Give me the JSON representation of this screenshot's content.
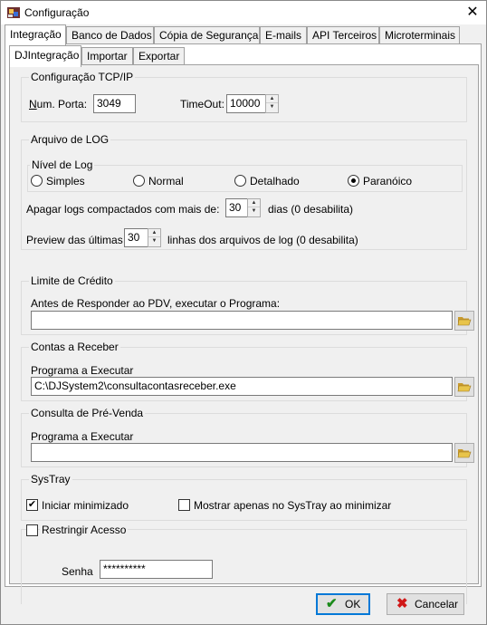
{
  "window": {
    "title": "Configuração",
    "close_glyph": "✕"
  },
  "main_tabs": [
    {
      "label": "Integração",
      "active": true
    },
    {
      "label": "Banco de Dados"
    },
    {
      "label": "Cópia de Segurança"
    },
    {
      "label": "E-mails"
    },
    {
      "label": "API Terceiros"
    },
    {
      "label": "Microterminais"
    }
  ],
  "sub_tabs": [
    {
      "label": "DJIntegração",
      "active": true
    },
    {
      "label": "Importar"
    },
    {
      "label": "Exportar"
    }
  ],
  "tcp": {
    "title": "Configuração TCP/IP",
    "port_label_prefix": "N",
    "port_label_rest": "um. Porta:",
    "port_value": "3049",
    "timeout_label": "TimeOut:",
    "timeout_value": "10000"
  },
  "log": {
    "title": "Arquivo de LOG",
    "level_title": "Nível de Log",
    "levels": [
      "Simples",
      "Normal",
      "Detalhado",
      "Paranóico"
    ],
    "selected_level": "Paranóico",
    "apagar_label": "Apagar logs compactados com mais de:",
    "apagar_value": "30",
    "apagar_suffix": "dias (0 desabilita)",
    "preview_label": "Preview das últimas",
    "preview_value": "30",
    "preview_suffix": "linhas dos arquivos de log (0 desabilita)"
  },
  "credito": {
    "title": "Limite de Crédito",
    "label": "Antes de Responder ao PDV, executar o Programa:",
    "value": ""
  },
  "contas": {
    "title": "Contas a Receber",
    "label": "Programa a Executar",
    "value": "C:\\DJSystem2\\consultacontasreceber.exe"
  },
  "prevenda": {
    "title": "Consulta de Pré-Venda",
    "label": "Programa a Executar",
    "value": ""
  },
  "systray": {
    "title": "SysTray",
    "iniciar_label": "Iniciar minimizado",
    "iniciar_checked": true,
    "mostrar_label": "Mostrar apenas no SysTray ao minimizar",
    "mostrar_checked": false
  },
  "acesso": {
    "restringir_label": "Restringir Acesso",
    "restringir_checked": false,
    "senha_label": "Senha",
    "senha_value": "**********"
  },
  "buttons": {
    "ok": "OK",
    "cancel": "Cancelar"
  },
  "icons": {
    "app": "app-icon",
    "folder": "folder-open-icon",
    "ok": "check-icon",
    "cancel": "x-icon"
  },
  "colors": {
    "accent": "#0078d7",
    "ok_check": "#1a8a1a",
    "cancel_x": "#d01818",
    "folder": "#e8c44a"
  }
}
